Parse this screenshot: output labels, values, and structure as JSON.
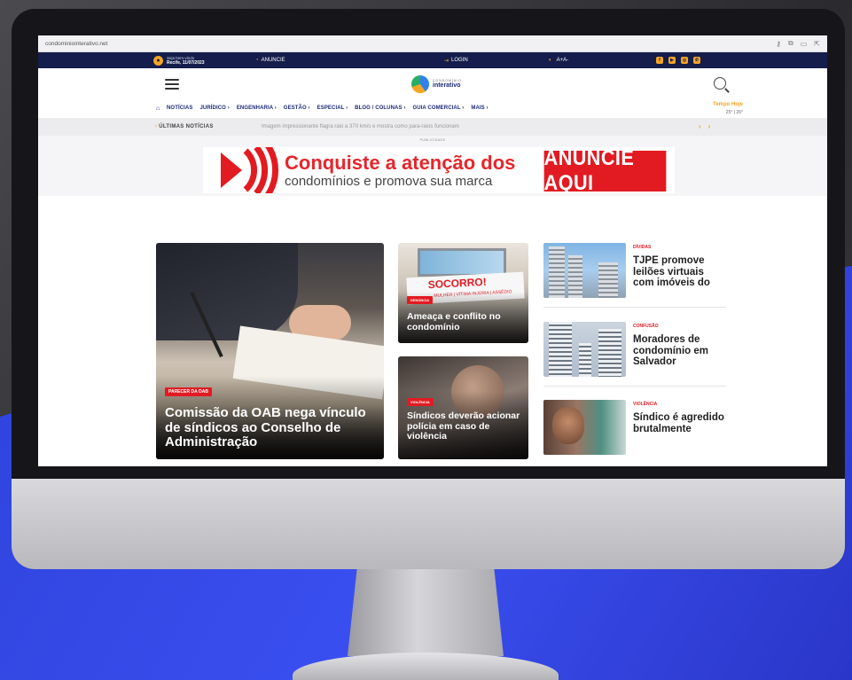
{
  "browser": {
    "url": "condominiointerativo.net"
  },
  "topbar": {
    "welcome_line1": "Seja bem-vindo",
    "welcome_line2": "Recife, 11/07/2023",
    "anuncie": "ANUNCIE",
    "login": "LOGIN",
    "font_size": "A+A-"
  },
  "header": {
    "logo_line1": "CONDOMÍNIO",
    "logo_line2": "interativo"
  },
  "nav": {
    "items": [
      "NOTÍCIAS",
      "JURÍDICO ›",
      "ENGENHARIA ›",
      "GESTÃO ›",
      "ESPECIAL ›",
      "BLOG / COLUNAS ›",
      "GUIA COMERCIAL ›",
      "MAIS ›"
    ],
    "weather_label": "Tempo Hoje",
    "weather_value": "25° | 26°"
  },
  "ticker": {
    "label": "ÚLTIMAS NOTÍCIAS",
    "headline": "Imagem impressionante flagra raio a 370 km/s e mostra como para-raios funcionam"
  },
  "ad": {
    "label": "PUBLICIDADE",
    "title": "Conquiste a atenção dos",
    "subtitle": "condomínios e promova sua marca",
    "cta": "ANUNCIE AQUI"
  },
  "featured": {
    "tag": "PARECER DA OAB",
    "title": "Comissão da OAB nega vínculo de síndicos ao Conselho de Administração"
  },
  "middle": [
    {
      "tag": "DENÚNCIA",
      "title": "Ameaça e conflito no condomínio",
      "sign_big": "SOCORRO!",
      "sign_small": "MULHER | VÍTIMA INJÚRIA | ASSÉDIO"
    },
    {
      "tag": "VIOLÊNCIA",
      "title": "Síndicos deverão acionar polícia em caso de violência"
    }
  ],
  "sidebar": [
    {
      "category": "DÍVIDAS",
      "title": "TJPE promove leilões virtuais com imóveis do"
    },
    {
      "category": "CONFUSÃO",
      "title": "Moradores de condomínio em Salvador"
    },
    {
      "category": "VIOLÊNCIA",
      "title": "Síndico é agredido brutalmente"
    }
  ],
  "colors": {
    "navy": "#141d4b",
    "accent_orange": "#f5a524",
    "brand_red": "#e21b22",
    "background_blue": "#3a4ff0"
  },
  "icons": [
    "location-pin-icon",
    "megaphone-icon",
    "login-icon",
    "contrast-icon",
    "facebook-icon",
    "youtube-icon",
    "instagram-icon",
    "whatsapp-icon",
    "menu-icon",
    "search-icon",
    "home-icon",
    "weather-icon",
    "chevron-left-icon",
    "chevron-right-icon"
  ]
}
